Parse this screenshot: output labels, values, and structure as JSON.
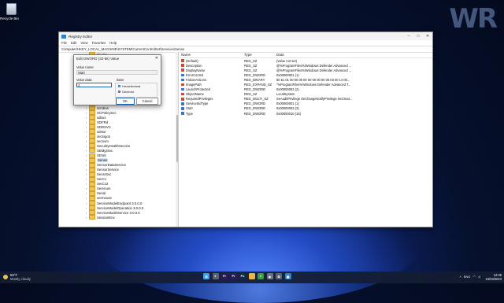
{
  "desktop": {
    "recycle_bin_label": "Recycle Bin",
    "watermark": "WR"
  },
  "regedit": {
    "title": "Registry Editor",
    "menu": [
      "File",
      "Edit",
      "View",
      "Favorites",
      "Help"
    ],
    "address": "Computer\\HKEY_LOCAL_MACHINE\\SYSTEM\\CurrentControlSet\\Services\\Sense",
    "tree_items": [
      {
        "label": "RpcSs",
        "top": true
      },
      {
        "label": "scmbus"
      },
      {
        "label": "SCPolicySvc"
      },
      {
        "label": "sdbus"
      },
      {
        "label": "SDFRd"
      },
      {
        "label": "SDRSVC"
      },
      {
        "label": "sdstor"
      },
      {
        "label": "seclogon"
      },
      {
        "label": "secnvm"
      },
      {
        "label": "SecurityHealthService"
      },
      {
        "label": "SEMgrSvc"
      },
      {
        "label": "SENS"
      },
      {
        "label": "Sense",
        "selected": true
      },
      {
        "label": "SensorDataService"
      },
      {
        "label": "SensorService"
      },
      {
        "label": "SensrSvc"
      },
      {
        "label": "SerCx"
      },
      {
        "label": "SerCx2"
      },
      {
        "label": "Serenum"
      },
      {
        "label": "Serial"
      },
      {
        "label": "sermouse"
      },
      {
        "label": "ServiceModelEndpoint 3.0.0.0"
      },
      {
        "label": "ServiceModelOperation 3.0.0.0"
      },
      {
        "label": "ServiceModelService 3.0.0.0"
      },
      {
        "label": "SessionEnv"
      }
    ],
    "list_headers": {
      "name": "Name",
      "type": "Type",
      "data": "Data"
    },
    "values": [
      {
        "name": "(Default)",
        "type": "REG_SZ",
        "data": "(value not set)",
        "icon": "sz"
      },
      {
        "name": "Description",
        "type": "REG_SZ",
        "data": "@%ProgramFiles%\\Windows Defender Advanced ...",
        "icon": "sz"
      },
      {
        "name": "DisplayName",
        "type": "REG_SZ",
        "data": "@%ProgramFiles%\\Windows Defender Advanced ...",
        "icon": "sz"
      },
      {
        "name": "ErrorControl",
        "type": "REG_DWORD",
        "data": "0x00000001 (1)",
        "icon": "bin"
      },
      {
        "name": "FailureActions",
        "type": "REG_BINARY",
        "data": "80 51 01 00 00 00 00 00 00 00 00 00 03 00 14 00...",
        "icon": "bin"
      },
      {
        "name": "ImagePath",
        "type": "REG_EXPAND_SZ",
        "data": "\"%ProgramFiles%\\Windows Defender Advanced T...",
        "icon": "sz"
      },
      {
        "name": "LaunchProtected",
        "type": "REG_DWORD",
        "data": "0x00000002 (2)",
        "icon": "bin"
      },
      {
        "name": "ObjectName",
        "type": "REG_SZ",
        "data": "LocalSystem",
        "icon": "sz"
      },
      {
        "name": "RequiredPrivileges",
        "type": "REG_MULTI_SZ",
        "data": "SeAuditPrivilege SeChangeNotifyPrivilege SeCreat...",
        "icon": "sz"
      },
      {
        "name": "ServiceSidType",
        "type": "REG_DWORD",
        "data": "0x00000001 (1)",
        "icon": "bin"
      },
      {
        "name": "Start",
        "type": "REG_DWORD",
        "data": "0x00000003 (3)",
        "icon": "bin"
      },
      {
        "name": "Type",
        "type": "REG_DWORD",
        "data": "0x00000010 (16)",
        "icon": "bin"
      }
    ]
  },
  "dialog": {
    "title": "Edit DWORD (32-bit) Value",
    "value_name_label": "Value name:",
    "value_name": "Start",
    "value_data_label": "Value data:",
    "value_data": "4",
    "base_label": "Base",
    "base_options": [
      "Hexadecimal",
      "Decimal"
    ],
    "base_selected": "Hexadecimal",
    "ok": "OK",
    "cancel": "Cancel"
  },
  "taskbar": {
    "weather_temp": "59°F",
    "weather_desc": "Mostly cloudy",
    "time": "12:06",
    "date": "24/04/2023",
    "lang": "ENG",
    "apps": [
      {
        "name": "windows-start-icon",
        "color": "#3aa0f0",
        "glyph": "⊞"
      },
      {
        "name": "search-icon",
        "color": "#5a6275",
        "glyph": "⌕"
      },
      {
        "name": "premiere-icon",
        "color": "#2a1a5e",
        "glyph": "Pr"
      },
      {
        "name": "premiere-alt-icon",
        "color": "#2a1a5e",
        "glyph": "Pr"
      },
      {
        "name": "photoshop-icon",
        "color": "#0f2a4a",
        "glyph": "Ps"
      },
      {
        "name": "folder-icon",
        "color": "#e7b93c",
        "glyph": ""
      },
      {
        "name": "chrome-icon",
        "color": "#3c9a4a",
        "glyph": "●"
      },
      {
        "name": "app-gray-icon",
        "color": "#6c7384",
        "glyph": "◆"
      },
      {
        "name": "settings-icon",
        "color": "#5a6275",
        "glyph": "⚙"
      },
      {
        "name": "regedit-icon",
        "color": "#2d7fd0",
        "glyph": "▦"
      }
    ]
  }
}
